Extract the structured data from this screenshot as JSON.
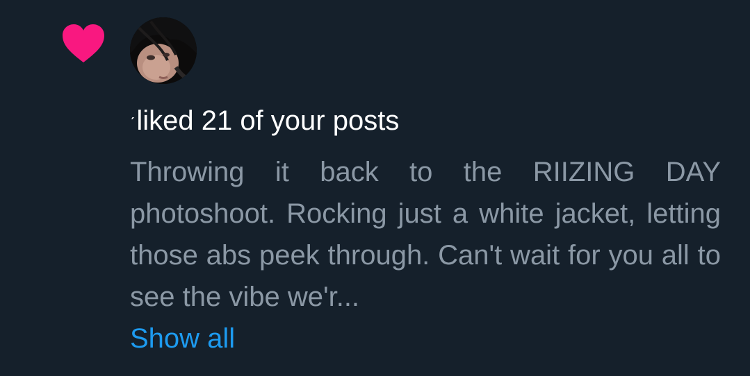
{
  "notification": {
    "type_icon": "heart-icon",
    "icon_color": "#f91880",
    "avatar": "user-avatar-photo",
    "name_mark": "ˊ",
    "headline": "liked 21 of your posts",
    "post_preview": "Throwing it back to the RIIZING DAY photoshoot. Rocking just a white jacket, letting those abs peek through. Can't wait for you all to see the vibe we'r...",
    "show_all_label": "Show all"
  },
  "colors": {
    "background": "#15202b",
    "primary_text": "#ffffff",
    "secondary_text": "#8b98a5",
    "link": "#1d9bf0"
  }
}
